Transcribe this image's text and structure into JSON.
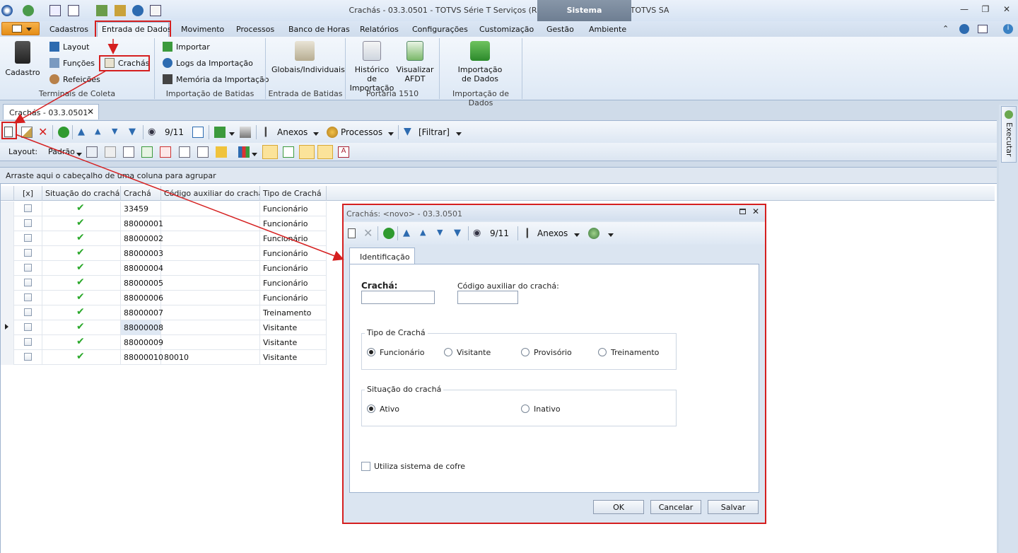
{
  "window": {
    "title": "Crachás - 03.3.0501 - TOTVS Série T Serviços (RM) Alias: CorporeRM | 1-TOTVS SA",
    "context_tab": "Sistema"
  },
  "ribbon": {
    "tabs": [
      "Cadastros",
      "Entrada de Dados",
      "Movimento",
      "Processos",
      "Banco de Horas",
      "Relatórios",
      "Configurações",
      "Customização",
      "Gestão",
      "Ambiente"
    ],
    "active_tab": "Entrada de Dados",
    "groups": {
      "terminais": {
        "label": "Terminais de Coleta",
        "cadastro": "Cadastro",
        "layout": "Layout",
        "funcoes": "Funções",
        "refeicoes": "Refeições",
        "crachas": "Crachás"
      },
      "importacao_batidas": {
        "label": "Importação de Batidas",
        "importar": "Importar",
        "logs": "Logs da Importação",
        "memoria": "Memória da Importação"
      },
      "entrada_batidas": {
        "label": "Entrada de Batidas",
        "globais": "Globais/Individuais"
      },
      "portaria": {
        "label": "Portaria 1510",
        "historico_1": "Histórico de",
        "historico_2": "Importação",
        "visualizar_1": "Visualizar",
        "visualizar_2": "AFDT"
      },
      "importacao_dados": {
        "label": "Importação de Dados",
        "btn_1": "Importação",
        "btn_2": "de Dados"
      }
    }
  },
  "doc_tab": {
    "label": "Crachás - 03.3.0501"
  },
  "toolbar": {
    "record_pos": "9/11",
    "anexos": "Anexos",
    "processos": "Processos",
    "filtrar": "[Filtrar]",
    "layout_label": "Layout:",
    "layout_value": "Padrão"
  },
  "side_panel": {
    "label": "Executar"
  },
  "grid": {
    "group_hint": "Arraste aqui o cabeçalho de uma coluna para agrupar",
    "columns": [
      "[x]",
      "Situação do crachá",
      "Crachá",
      "Código auxiliar do crachá",
      "Tipo de Crachá"
    ],
    "rows": [
      {
        "cracha": "33459",
        "aux": "",
        "tipo": "Funcionário"
      },
      {
        "cracha": "88000001",
        "aux": "",
        "tipo": "Funcionário"
      },
      {
        "cracha": "88000002",
        "aux": "",
        "tipo": "Funcionário"
      },
      {
        "cracha": "88000003",
        "aux": "",
        "tipo": "Funcionário"
      },
      {
        "cracha": "88000004",
        "aux": "",
        "tipo": "Funcionário"
      },
      {
        "cracha": "88000005",
        "aux": "",
        "tipo": "Funcionário"
      },
      {
        "cracha": "88000006",
        "aux": "",
        "tipo": "Funcionário"
      },
      {
        "cracha": "88000007",
        "aux": "",
        "tipo": "Treinamento"
      },
      {
        "cracha": "88000008",
        "aux": "",
        "tipo": "Visitante"
      },
      {
        "cracha": "88000009",
        "aux": "",
        "tipo": "Visitante"
      },
      {
        "cracha": "88000010",
        "aux": "80010",
        "tipo": "Visitante"
      }
    ],
    "selected_row": 8
  },
  "dialog": {
    "title": "Crachás: <novo> - 03.3.0501",
    "record_pos": "9/11",
    "anexos": "Anexos",
    "tab": "Identificação",
    "cracha_label": "Crachá:",
    "cracha_value": "",
    "aux_label": "Código auxiliar do crachá:",
    "aux_value": "",
    "tipo_legend": "Tipo de Crachá",
    "tipo_options": [
      "Funcionário",
      "Visitante",
      "Provisório",
      "Treinamento"
    ],
    "tipo_selected": "Funcionário",
    "situacao_legend": "Situação do crachá",
    "situacao_options": [
      "Ativo",
      "Inativo"
    ],
    "situacao_selected": "Ativo",
    "cofre_label": "Utiliza sistema de cofre",
    "ok": "OK",
    "cancelar": "Cancelar",
    "salvar": "Salvar"
  },
  "colors": {
    "accent_red": "#d51f1f",
    "ok_green": "#2aa82a",
    "ribbon_orange": "#e48d16"
  }
}
